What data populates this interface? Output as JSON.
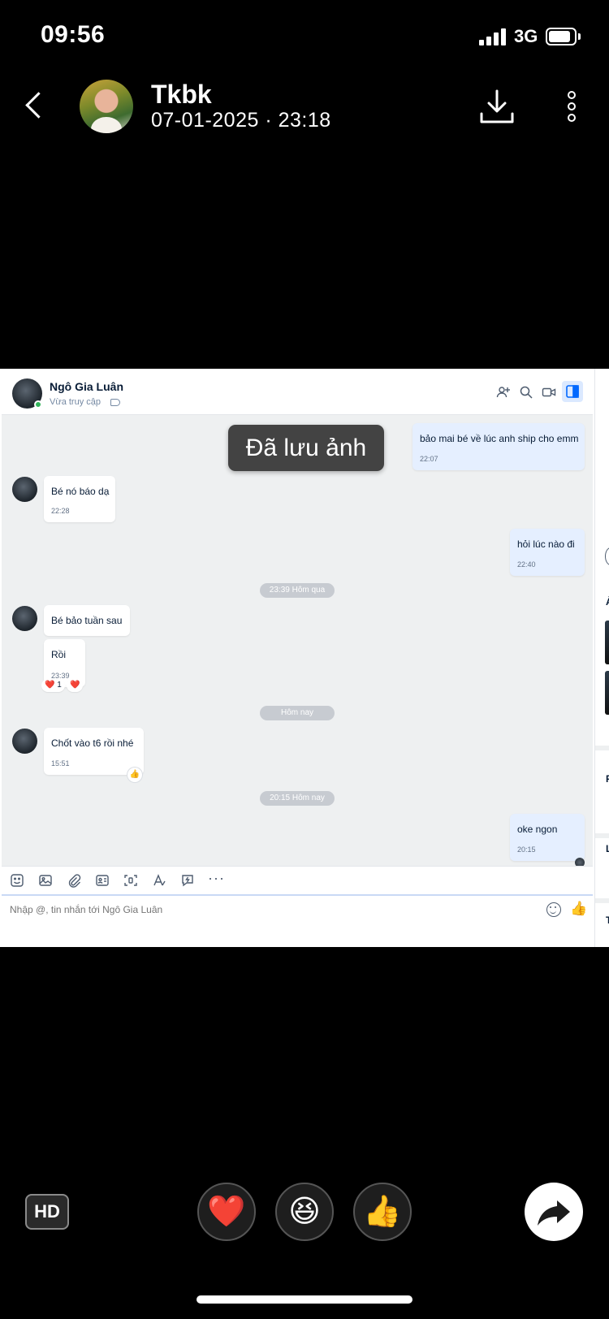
{
  "status_bar": {
    "time": "09:56",
    "network": "3G",
    "signal_icon": "cellular-signal-icon",
    "battery_icon": "battery-icon",
    "battery_level": 0.75
  },
  "viewer": {
    "back_icon": "chevron-left-icon",
    "sender_name": "Tkbk",
    "sent_time": "07-01-2025 · 23:18",
    "download_icon": "download-icon",
    "more_icon": "more-vertical-icon"
  },
  "chat": {
    "contact_name": "Ngô Gia Luân",
    "contact_status": "Vừa truy cập",
    "header_icons": [
      "add-member-icon",
      "search-icon",
      "video-call-icon",
      "toggle-panel-icon"
    ],
    "toast": "Đã lưu ảnh",
    "messages": [
      {
        "dir": "out",
        "text": "bảo mai bé về lúc anh ship cho emm",
        "time": "22:07"
      },
      {
        "dir": "in",
        "text": "Bé nó báo dạ",
        "time": "22:28"
      },
      {
        "dir": "out",
        "text": "hỏi lúc nào đi",
        "time": "22:40"
      },
      {
        "dir": "in",
        "text": "Bé bảo tuần sau",
        "time": ""
      },
      {
        "dir": "in",
        "text": "Rồi",
        "time": "23:39"
      },
      {
        "dir": "in",
        "text": "Chốt vào t6 rồi nhé",
        "time": "15:51"
      },
      {
        "dir": "out",
        "text": "oke ngon",
        "time": "20:15"
      }
    ],
    "separators": [
      "23:39 Hôm qua",
      "Hôm nay",
      "20:15 Hôm nay"
    ],
    "reaction": {
      "emoji": "❤️",
      "count": "1",
      "quick_emoji": "❤️"
    },
    "toolbar_icons": [
      "sticker-icon",
      "image-icon",
      "attachment-icon",
      "contact-card-icon",
      "screenshot-icon",
      "text-format-icon",
      "quick-message-icon",
      "more-horizontal-icon"
    ],
    "composer_placeholder": "Nhập @, tin nhắn tới Ngô Gia Luân",
    "emoji_icon": "emoji-icon",
    "quick_like": "👍",
    "side_panel_letters": [
      "Ả",
      "F",
      "L",
      "T"
    ]
  },
  "bottom": {
    "hd_label": "HD",
    "reactions": [
      "❤️",
      "😆",
      "👍"
    ],
    "share_icon": "share-forward-icon"
  }
}
